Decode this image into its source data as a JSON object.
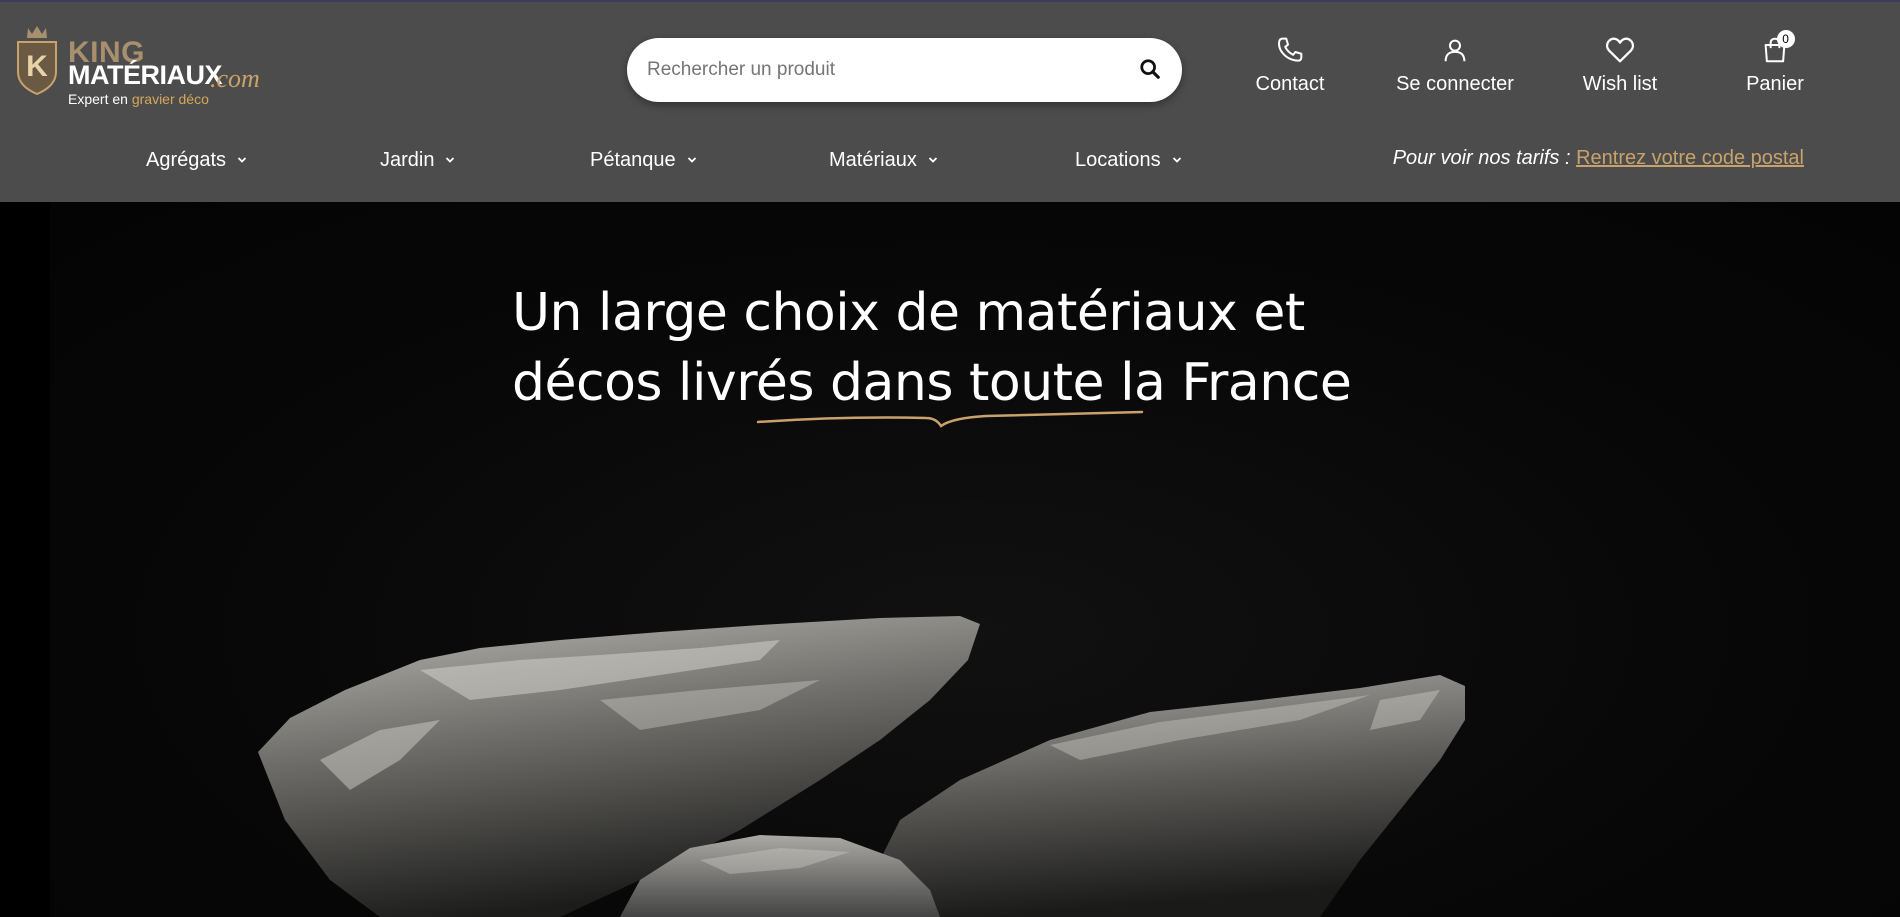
{
  "logo": {
    "brand_top": "KING",
    "brand_bottom": "MATÉRIAUX",
    "brand_suffix": ".com",
    "tagline_prefix": "Expert en",
    "tagline_accent": "gravier déco",
    "crest_letter": "K"
  },
  "search": {
    "placeholder": "Rechercher un produit",
    "icon": "search-icon"
  },
  "actions": {
    "contact": {
      "label": "Contact",
      "icon": "phone-icon"
    },
    "login": {
      "label": "Se connecter",
      "icon": "user-icon"
    },
    "wishlist": {
      "label": "Wish list",
      "icon": "heart-icon"
    },
    "cart": {
      "label": "Panier",
      "icon": "shopping-bag-icon",
      "count": "0"
    }
  },
  "nav": {
    "items": [
      {
        "label": "Agrégats"
      },
      {
        "label": "Jardin"
      },
      {
        "label": "Pétanque"
      },
      {
        "label": "Matériaux"
      },
      {
        "label": "Locations"
      }
    ],
    "price_note": "Pour voir nos tarifs :",
    "price_link": "Rentrez votre code postal"
  },
  "hero": {
    "title_line1": "Un large choix de matériaux et",
    "title_line2": "décos livrés dans toute la France"
  },
  "colors": {
    "header_bg": "#4c4c4c",
    "accent_gold": "#c9a26b",
    "hero_bg": "#000000",
    "text": "#ffffff"
  }
}
